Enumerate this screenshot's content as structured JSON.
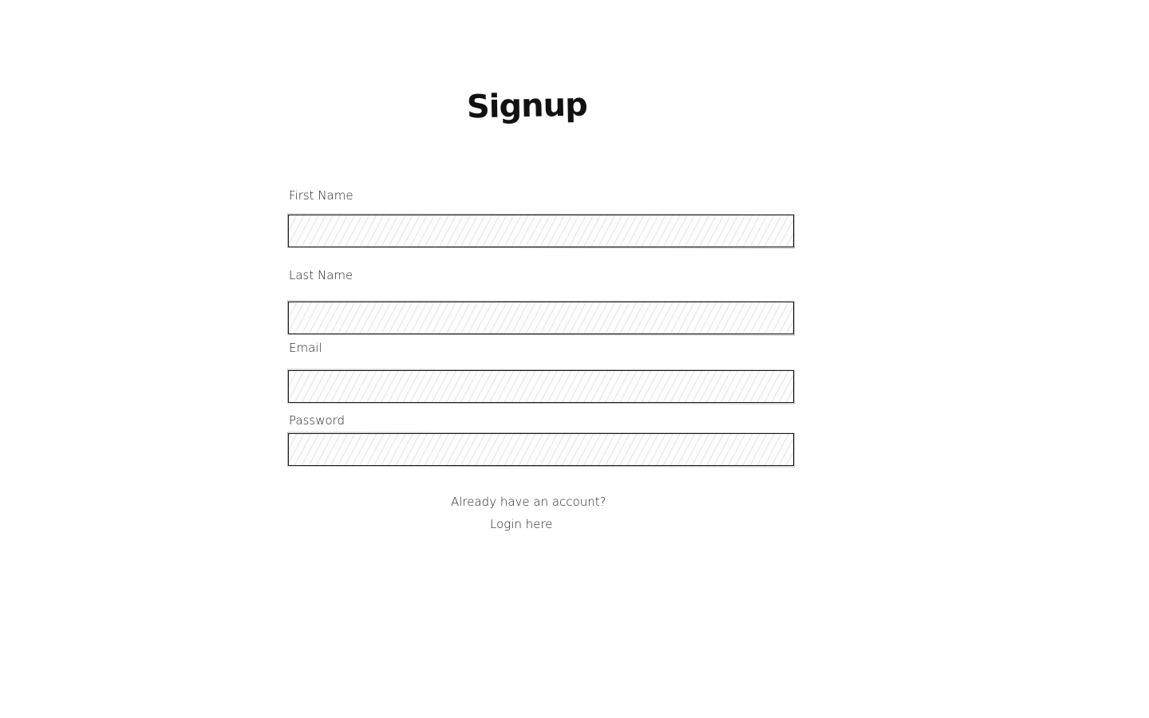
{
  "form": {
    "title": "Signup",
    "fields": [
      {
        "label": "First Name",
        "value": "",
        "placeholder": ""
      },
      {
        "label": "Last Name",
        "value": "",
        "placeholder": ""
      },
      {
        "label": "Email",
        "value": "",
        "placeholder": ""
      },
      {
        "label": "Password",
        "value": "",
        "placeholder": ""
      }
    ]
  },
  "footer": {
    "prompt": "Already have an account?",
    "login_link": "Login here"
  }
}
